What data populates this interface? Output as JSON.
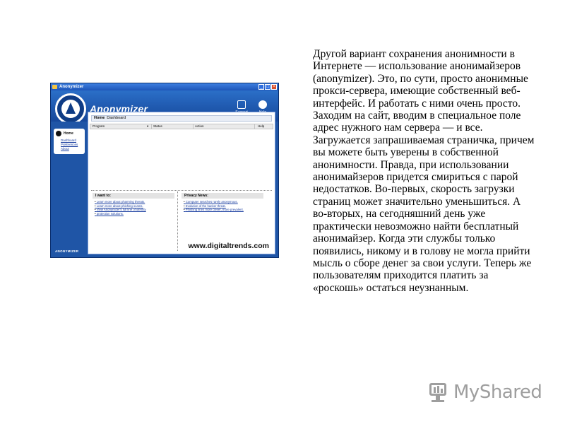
{
  "slide": {
    "text": "Другой вариант сохранения анонимности в Интернете — использование анонимайзеров (anonymizer). Это, по сути, просто анонимные прокси-сервера, имеющие собственный веб-интерфейс. И работать с ними очень просто. Заходим на сайт, вводим в специальное поле адрес нужного нам сервера — и все. Загружается запрашиваемая страничка, причем вы можете быть уверены в собственной анонимности. Правда, при использовании анонимайзеров придется смириться с парой недостатков. Во-первых, скорость загрузки страниц может значительно уменьшиться. А во-вторых, на сегодняшний день уже практически невозможно найти бесплатный анонимайзер. Когда эти службы только появились, никому и в голову не могла прийти мысль о сборе денег за свои услуги. Теперь же пользователям приходится платить за «роскошь» остаться неузнанным."
  },
  "screenshot": {
    "window_title": "Anonymizer",
    "app_name": "Anonymizer",
    "header_buttons": {
      "support": "Support",
      "help": "Help"
    },
    "breadcrumb": {
      "home": "Home",
      "current": "Dashboard"
    },
    "nav": {
      "home": "Home",
      "items": [
        "Dashboard",
        "Preferences",
        "About"
      ]
    },
    "table_headers": {
      "program": "Program",
      "status": "Status",
      "action": "Action",
      "help": "Help"
    },
    "panel_left": {
      "title": "I want to:",
      "links": [
        "Learn more about pharming threats.",
        "Learn more about phishing scams.",
        "View Anonymizer's full line of identity",
        "protection solutions."
      ]
    },
    "panel_right": {
      "title": "Privacy News:",
      "links": [
        "Computer searches rarely anonymous.",
        "Evolution of the hacker threat.",
        "Phishing lines more clever, more prevalent."
      ]
    },
    "brand_footer": "ANONYMIZER",
    "watermark": "www.digitaltrends.com"
  },
  "logo": {
    "text": "MyShared"
  }
}
